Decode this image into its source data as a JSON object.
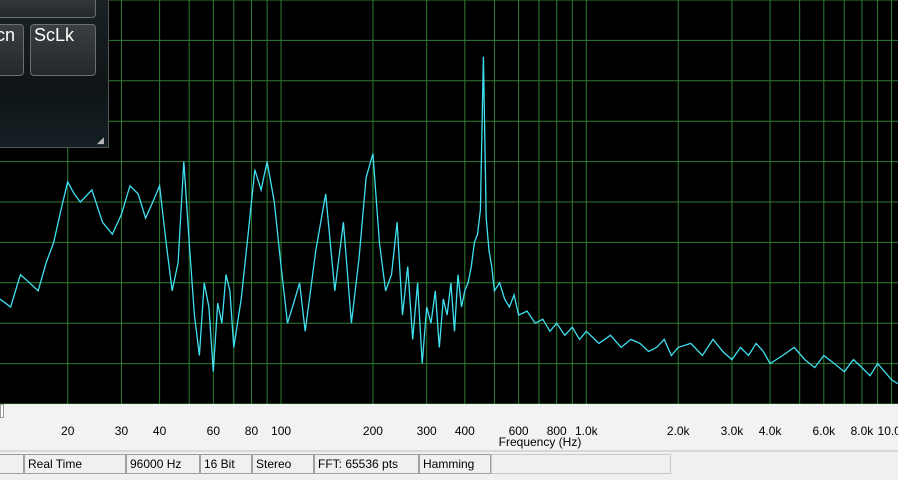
{
  "keyboard": {
    "keys": [
      "cn",
      "ScLk"
    ],
    "grip_icon": "resize-grip-icon"
  },
  "chart_data": {
    "type": "line",
    "x_scale": "log",
    "xlabel": "Frequency (Hz)",
    "x_ticks": [
      "20",
      "30",
      "40",
      "60",
      "80",
      "100",
      "200",
      "300",
      "400",
      "600",
      "800",
      "1.0k",
      "2.0k",
      "3.0k",
      "4.0k",
      "6.0k",
      "8.0k",
      "10.0k"
    ],
    "x_tick_values": [
      20,
      30,
      40,
      60,
      80,
      100,
      200,
      300,
      400,
      600,
      800,
      1000,
      2000,
      3000,
      4000,
      6000,
      8000,
      10000
    ],
    "xlim": [
      12,
      10500
    ],
    "ylim": [
      -100,
      0
    ],
    "grid": true,
    "line_color": "#40e0f0",
    "grid_color": "#2e7d32",
    "series": [
      {
        "x": [
          12,
          13,
          14,
          15,
          16,
          17,
          18,
          19,
          20,
          21,
          22,
          24,
          26,
          28,
          30,
          32,
          34,
          36,
          38,
          40,
          42,
          44,
          46,
          48,
          50,
          52,
          54,
          56,
          58,
          60,
          62,
          64,
          66,
          68,
          70,
          74,
          78,
          82,
          86,
          90,
          95,
          100,
          105,
          110,
          115,
          120,
          130,
          140,
          150,
          160,
          170,
          180,
          190,
          200,
          210,
          220,
          230,
          240,
          250,
          260,
          270,
          280,
          290,
          300,
          310,
          320,
          330,
          340,
          350,
          360,
          370,
          380,
          390,
          400,
          410,
          420,
          430,
          440,
          450,
          460,
          470,
          480,
          490,
          500,
          520,
          540,
          560,
          580,
          600,
          640,
          680,
          720,
          760,
          800,
          850,
          900,
          950,
          1000,
          1100,
          1200,
          1300,
          1400,
          1500,
          1600,
          1700,
          1800,
          1900,
          2000,
          2200,
          2400,
          2600,
          2800,
          3000,
          3200,
          3400,
          3600,
          3800,
          4000,
          4400,
          4800,
          5200,
          5600,
          6000,
          6500,
          7000,
          7500,
          8000,
          8500,
          9000,
          9500,
          10000,
          10500
        ],
        "y": [
          -74,
          -76,
          -68,
          -70,
          -72,
          -65,
          -60,
          -52,
          -45,
          -48,
          -50,
          -47,
          -55,
          -58,
          -53,
          -46,
          -48,
          -54,
          -50,
          -46,
          -60,
          -72,
          -65,
          -40,
          -60,
          -78,
          -88,
          -70,
          -76,
          -92,
          -75,
          -80,
          -68,
          -72,
          -86,
          -74,
          -58,
          -42,
          -47,
          -40,
          -50,
          -66,
          -80,
          -75,
          -70,
          -82,
          -62,
          -48,
          -72,
          -55,
          -80,
          -64,
          -44,
          -38,
          -60,
          -72,
          -68,
          -55,
          -78,
          -66,
          -84,
          -70,
          -90,
          -76,
          -80,
          -72,
          -86,
          -74,
          -78,
          -70,
          -82,
          -68,
          -76,
          -72,
          -70,
          -66,
          -60,
          -58,
          -52,
          -14,
          -54,
          -62,
          -66,
          -72,
          -70,
          -74,
          -76,
          -73,
          -78,
          -77,
          -80,
          -79,
          -82,
          -80,
          -83,
          -81,
          -84,
          -82,
          -85,
          -83,
          -86,
          -84,
          -85,
          -87,
          -86,
          -84,
          -88,
          -86,
          -85,
          -88,
          -84,
          -87,
          -89,
          -86,
          -88,
          -85,
          -87,
          -90,
          -88,
          -86,
          -89,
          -91,
          -88,
          -90,
          -92,
          -89,
          -91,
          -93,
          -90,
          -92,
          -94,
          -95
        ]
      }
    ]
  },
  "status": {
    "mode": "Real Time",
    "sample_rate": "96000 Hz",
    "bit_depth": "16 Bit",
    "channels": "Stereo",
    "fft": "FFT: 65536 pts",
    "window": "Hamming"
  }
}
